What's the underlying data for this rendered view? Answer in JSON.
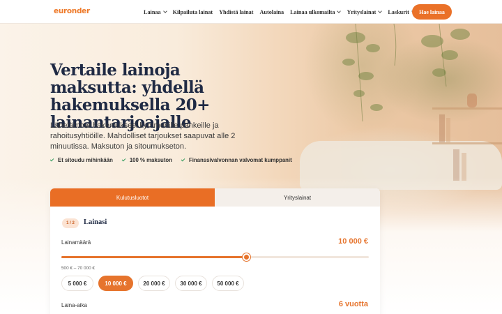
{
  "brand": {
    "logo": "euronder",
    "accent": "#ea7128"
  },
  "nav": {
    "items": [
      {
        "label": "Lainaa",
        "dropdown": true
      },
      {
        "label": "Kilpailuta lainat",
        "dropdown": false
      },
      {
        "label": "Yhdistä lainat",
        "dropdown": false
      },
      {
        "label": "Autolaina",
        "dropdown": false
      },
      {
        "label": "Lainaa ulkomailta",
        "dropdown": true
      },
      {
        "label": "Yrityslainat",
        "dropdown": true
      },
      {
        "label": "Laskurit",
        "dropdown": true
      }
    ],
    "cta_label": "Hae lainaa"
  },
  "hero": {
    "title": "Vertaile lainoja maksutta: yhdellä hakemuksella 20+ lainantarjoajalle",
    "subtitle": "Lähetämme hakemuksesi kymmenille pankeille ja rahoitusyhtiöille. Mahdolliset tarjoukset saapuvat alle 2 minuutissa. Maksuton ja sitoumukseton.",
    "checks": [
      "Et sitoudu mihinkään",
      "100 % maksuton",
      "Finanssivalvonnan valvomat kumppanit"
    ]
  },
  "form": {
    "tabs": [
      "Kulutusluotot",
      "Yrityslainat"
    ],
    "active_tab": 0,
    "step": "1 / 2",
    "step_title": "Lainasi",
    "amount": {
      "label": "Lainamäärä",
      "value": "10 000 €",
      "range_label": "500 € – 70 000 €",
      "slider_fraction": 0.6,
      "presets": [
        "5 000 €",
        "10 000 €",
        "20 000 €",
        "30 000 €",
        "50 000 €"
      ],
      "selected_preset": 1
    },
    "term": {
      "label": "Laina-aika",
      "value": "6 vuotta"
    }
  }
}
